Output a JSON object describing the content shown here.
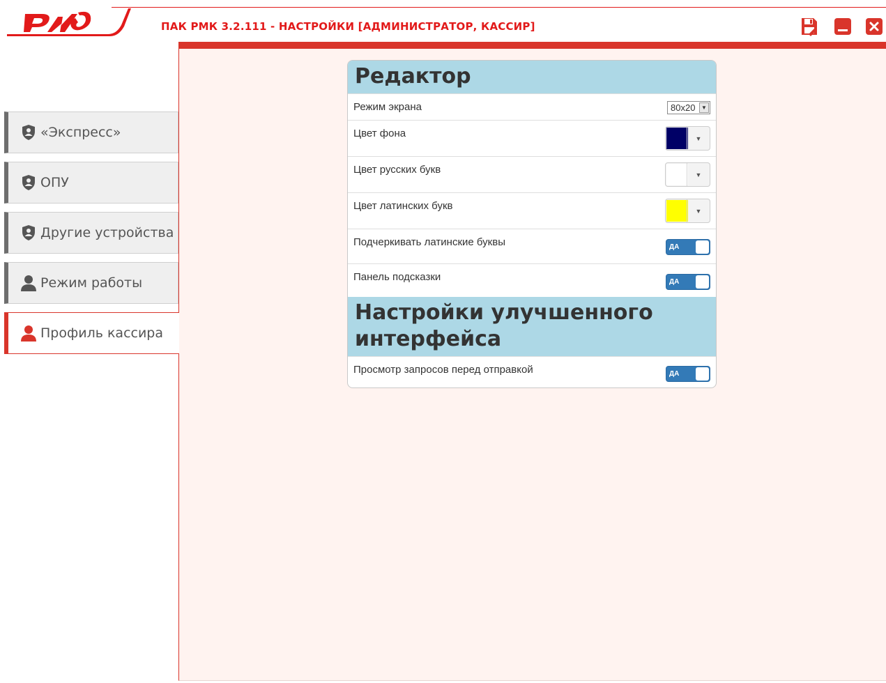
{
  "window": {
    "title": "ПАК РМК  3.2.111 - НАСТРОЙКИ [АДМИНИСТРАТОР, КАССИР]",
    "logo_icon": "rzd-logo-icon",
    "buttons": [
      "save-icon",
      "minimize-icon",
      "close-icon"
    ],
    "accent": "#e21a1a"
  },
  "sidebar": {
    "items": [
      {
        "label": "«Экспресс»",
        "icon": "shield-user-icon",
        "active": false
      },
      {
        "label": "ОПУ",
        "icon": "shield-user-icon",
        "active": false
      },
      {
        "label": "Другие устройства",
        "icon": "shield-user-icon",
        "active": false
      },
      {
        "label": "Режим работы",
        "icon": "user-icon",
        "active": false
      },
      {
        "label": "Профиль кассира",
        "icon": "user-icon",
        "active": true
      }
    ]
  },
  "editor": {
    "title": "Редактор",
    "screen_mode": {
      "label": "Режим экрана",
      "value": "80x20"
    },
    "bg_color": {
      "label": "Цвет фона",
      "color": "#000066"
    },
    "ru_color": {
      "label": "Цвет русских букв",
      "color": "#ffffff"
    },
    "lat_color": {
      "label": "Цвет латинских букв",
      "color": "#ffff00"
    },
    "underline_lat": {
      "label": "Подчеркивать латинские буквы",
      "toggle": "ДА"
    },
    "hint_panel": {
      "label": "Панель подсказки",
      "toggle": "ДА"
    }
  },
  "advanced": {
    "title": "Настройки улучшенного интерфейса",
    "preview_requests": {
      "label": "Просмотр запросов перед отправкой",
      "toggle": "ДА"
    }
  }
}
